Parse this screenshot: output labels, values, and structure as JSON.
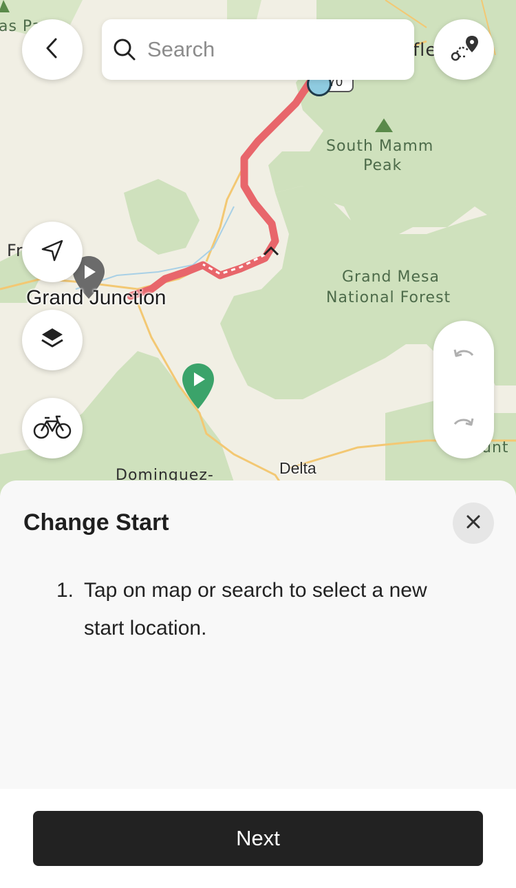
{
  "colors": {
    "route": "#e8666b",
    "forest": "#cfe1bd",
    "start_pin": "#3ba36a",
    "button_dark": "#222222"
  },
  "search": {
    "placeholder": "Search"
  },
  "map": {
    "labels": {
      "top_left_partial": "as Pa",
      "top_right_partial": "fle",
      "left_partial": "Fr",
      "mountain": "South Mamm",
      "mountain_line2": "Peak",
      "forest": "Grand Mesa",
      "forest_line2": "National Forest",
      "city": "Grand Junction",
      "town_delta": "Delta",
      "town_dominguez": "Dominguez-",
      "right_partial": "unt",
      "highway": "70"
    }
  },
  "icons": {
    "back": "chevron-left-icon",
    "route_planner": "route-pin-icon",
    "location": "navigation-arrow-icon",
    "layers": "layers-icon",
    "activity": "bicycle-icon",
    "undo": "undo-icon",
    "redo": "redo-icon",
    "close": "close-icon"
  },
  "sheet": {
    "title": "Change Start",
    "steps": [
      {
        "number": "1.",
        "text": "Tap on map or search to select a new start location."
      }
    ]
  },
  "footer": {
    "next_label": "Next"
  }
}
